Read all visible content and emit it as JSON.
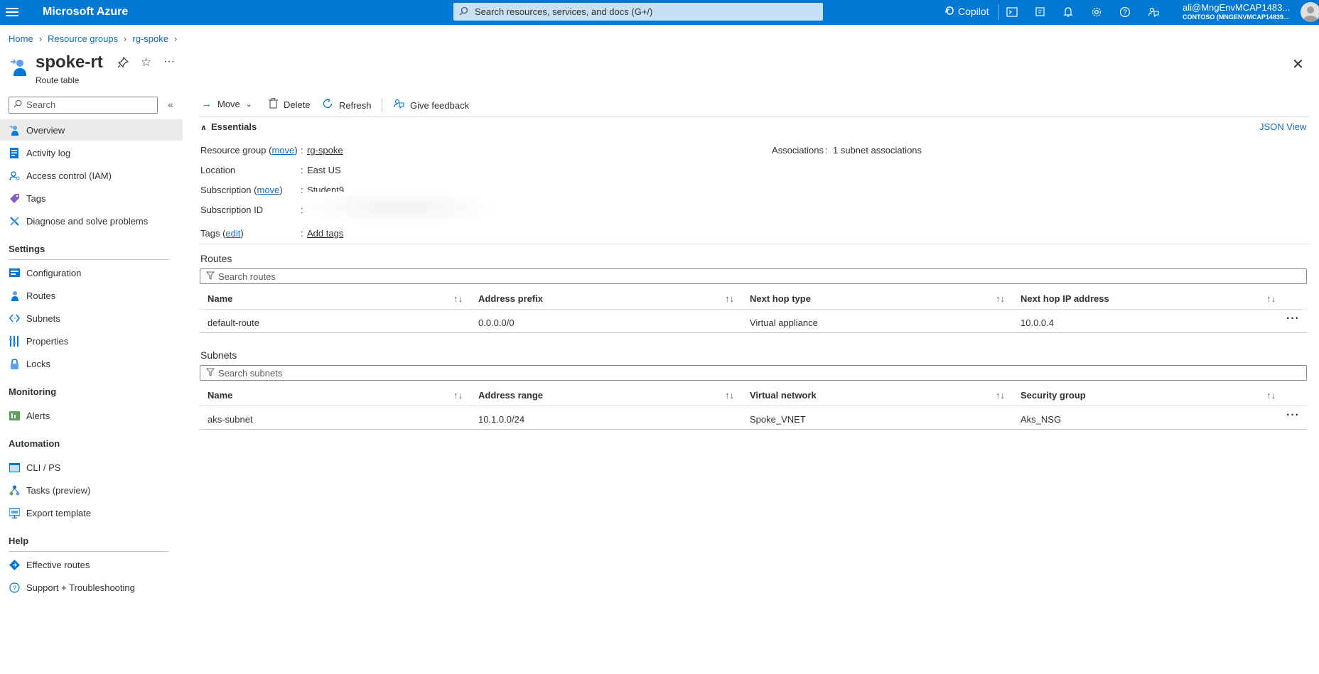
{
  "topbar": {
    "brand": "Microsoft Azure",
    "search_placeholder": "Search resources, services, and docs (G+/)",
    "copilot": "Copilot",
    "user_name": "ali@MngEnvMCAP1483...",
    "user_tenant": "CONTOSO (MNGENVMCAP14839..."
  },
  "breadcrumb": [
    "Home",
    "Resource groups",
    "rg-spoke"
  ],
  "header": {
    "title": "spoke-rt",
    "subtitle": "Route table"
  },
  "sidebar": {
    "search_placeholder": "Search",
    "items": [
      {
        "label": "Overview",
        "icon": "overview-icon"
      },
      {
        "label": "Activity log",
        "icon": "activity-log-icon"
      },
      {
        "label": "Access control (IAM)",
        "icon": "iam-icon"
      },
      {
        "label": "Tags",
        "icon": "tag-icon"
      },
      {
        "label": "Diagnose and solve problems",
        "icon": "diagnose-icon"
      }
    ],
    "sections": [
      {
        "title": "Settings",
        "items": [
          {
            "label": "Configuration",
            "icon": "configuration-icon"
          },
          {
            "label": "Routes",
            "icon": "routes-icon"
          },
          {
            "label": "Subnets",
            "icon": "subnets-icon"
          },
          {
            "label": "Properties",
            "icon": "properties-icon"
          },
          {
            "label": "Locks",
            "icon": "lock-icon"
          }
        ]
      },
      {
        "title": "Monitoring",
        "items": [
          {
            "label": "Alerts",
            "icon": "alerts-icon"
          }
        ]
      },
      {
        "title": "Automation",
        "items": [
          {
            "label": "CLI / PS",
            "icon": "cli-icon"
          },
          {
            "label": "Tasks (preview)",
            "icon": "tasks-icon"
          },
          {
            "label": "Export template",
            "icon": "export-template-icon"
          }
        ]
      },
      {
        "title": "Help",
        "items": [
          {
            "label": "Effective routes",
            "icon": "effective-routes-icon"
          },
          {
            "label": "Support + Troubleshooting",
            "icon": "support-icon"
          }
        ]
      }
    ]
  },
  "toolbar": {
    "move": "Move",
    "delete": "Delete",
    "refresh": "Refresh",
    "feedback": "Give feedback"
  },
  "essentials": {
    "heading": "Essentials",
    "json_view": "JSON View",
    "resource_group_label": "Resource group",
    "move_link": "move",
    "resource_group_value": "rg-spoke",
    "location_label": "Location",
    "location_value": "East US",
    "subscription_label": "Subscription",
    "subscription_value": "Student9",
    "subscription_id_label": "Subscription ID",
    "tags_label": "Tags",
    "edit_link": "edit",
    "tags_value": "Add tags",
    "associations_label": "Associations",
    "associations_value": "1 subnet associations"
  },
  "routes": {
    "title": "Routes",
    "filter_placeholder": "Search routes",
    "columns": [
      "Name",
      "Address prefix",
      "Next hop type",
      "Next hop IP address"
    ],
    "rows": [
      [
        "default-route",
        "0.0.0.0/0",
        "Virtual appliance",
        "10.0.0.4"
      ]
    ]
  },
  "subnets": {
    "title": "Subnets",
    "filter_placeholder": "Search subnets",
    "columns": [
      "Name",
      "Address range",
      "Virtual network",
      "Security group"
    ],
    "rows": [
      [
        "aks-subnet",
        "10.1.0.0/24",
        "Spoke_VNET",
        "Aks_NSG"
      ]
    ]
  },
  "colors": {
    "azure_blue": "#0078d4",
    "link": "#0f6cbd",
    "active_nav": "#edebe9"
  }
}
